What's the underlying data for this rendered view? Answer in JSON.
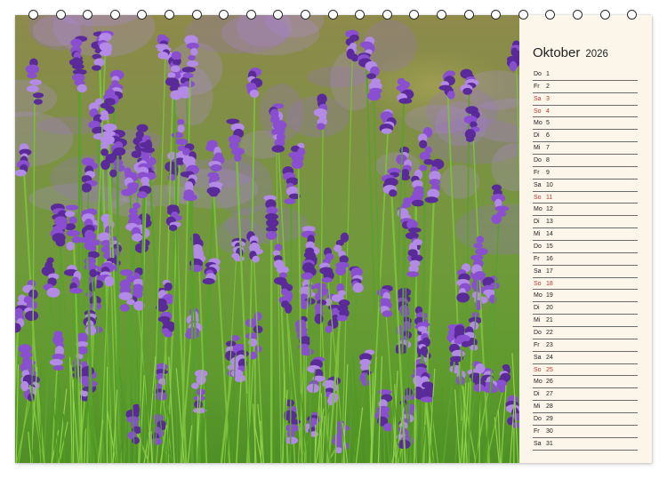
{
  "calendar": {
    "month": "Oktober",
    "year": "2026",
    "days": [
      {
        "wd": "Do",
        "d": "1",
        "sun": false
      },
      {
        "wd": "Fr",
        "d": "2",
        "sun": false
      },
      {
        "wd": "Sa",
        "d": "3",
        "sun": true
      },
      {
        "wd": "So",
        "d": "4",
        "sun": true
      },
      {
        "wd": "Mo",
        "d": "5",
        "sun": false
      },
      {
        "wd": "Di",
        "d": "6",
        "sun": false
      },
      {
        "wd": "Mi",
        "d": "7",
        "sun": false
      },
      {
        "wd": "Do",
        "d": "8",
        "sun": false
      },
      {
        "wd": "Fr",
        "d": "9",
        "sun": false
      },
      {
        "wd": "Sa",
        "d": "10",
        "sun": false
      },
      {
        "wd": "So",
        "d": "11",
        "sun": true
      },
      {
        "wd": "Mo",
        "d": "12",
        "sun": false
      },
      {
        "wd": "Di",
        "d": "13",
        "sun": false
      },
      {
        "wd": "Mi",
        "d": "14",
        "sun": false
      },
      {
        "wd": "Do",
        "d": "15",
        "sun": false
      },
      {
        "wd": "Fr",
        "d": "16",
        "sun": false
      },
      {
        "wd": "Sa",
        "d": "17",
        "sun": false
      },
      {
        "wd": "So",
        "d": "18",
        "sun": true
      },
      {
        "wd": "Mo",
        "d": "19",
        "sun": false
      },
      {
        "wd": "Di",
        "d": "20",
        "sun": false
      },
      {
        "wd": "Mi",
        "d": "21",
        "sun": false
      },
      {
        "wd": "Do",
        "d": "22",
        "sun": false
      },
      {
        "wd": "Fr",
        "d": "23",
        "sun": false
      },
      {
        "wd": "Sa",
        "d": "24",
        "sun": false
      },
      {
        "wd": "So",
        "d": "25",
        "sun": true
      },
      {
        "wd": "Mo",
        "d": "26",
        "sun": false
      },
      {
        "wd": "Di",
        "d": "27",
        "sun": false
      },
      {
        "wd": "Mi",
        "d": "28",
        "sun": false
      },
      {
        "wd": "Do",
        "d": "29",
        "sun": false
      },
      {
        "wd": "Fr",
        "d": "30",
        "sun": false
      },
      {
        "wd": "Sa",
        "d": "31",
        "sun": false
      }
    ]
  },
  "photo": {
    "subject": "lavender-field",
    "colors": {
      "flower": "#8a4fd0",
      "flower_dark": "#5b2a9a",
      "flower_light": "#b48ae8",
      "stem": "#5aa02c"
    }
  },
  "colors": {
    "sunday": "#c0392b",
    "paper": "#fbf5ea",
    "rule": "#6b6b6b"
  },
  "binding": {
    "ring_count": 23
  }
}
